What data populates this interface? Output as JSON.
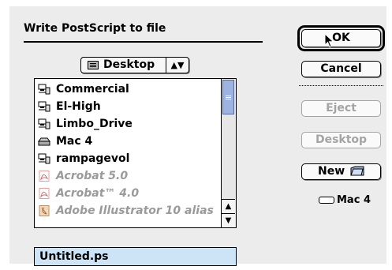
{
  "dialog": {
    "title": "Write PostScript to file",
    "location_popup": {
      "label": "Desktop",
      "icon": "desktop-folder-icon"
    },
    "files": [
      {
        "name": "Commercial",
        "icon": "network-volume-icon",
        "dimmed": false
      },
      {
        "name": "El-High",
        "icon": "network-volume-icon",
        "dimmed": false
      },
      {
        "name": "Limbo_Drive",
        "icon": "network-volume-icon",
        "dimmed": false
      },
      {
        "name": "Mac 4",
        "icon": "hard-disk-icon",
        "dimmed": false
      },
      {
        "name": "rampagevol",
        "icon": "network-volume-icon",
        "dimmed": false
      },
      {
        "name": "Acrobat 5.0",
        "icon": "acrobat-document-icon",
        "dimmed": true
      },
      {
        "name": "Acrobat™ 4.0",
        "icon": "acrobat-document-icon",
        "dimmed": true
      },
      {
        "name": "Adobe Illustrator 10 alias",
        "icon": "illustrator-alias-icon",
        "dimmed": true
      }
    ],
    "filename": "Untitled.ps",
    "buttons": {
      "ok": "OK",
      "cancel": "Cancel",
      "eject": "Eject",
      "desktop": "Desktop",
      "new": "New"
    },
    "current_disk": "Mac 4"
  }
}
